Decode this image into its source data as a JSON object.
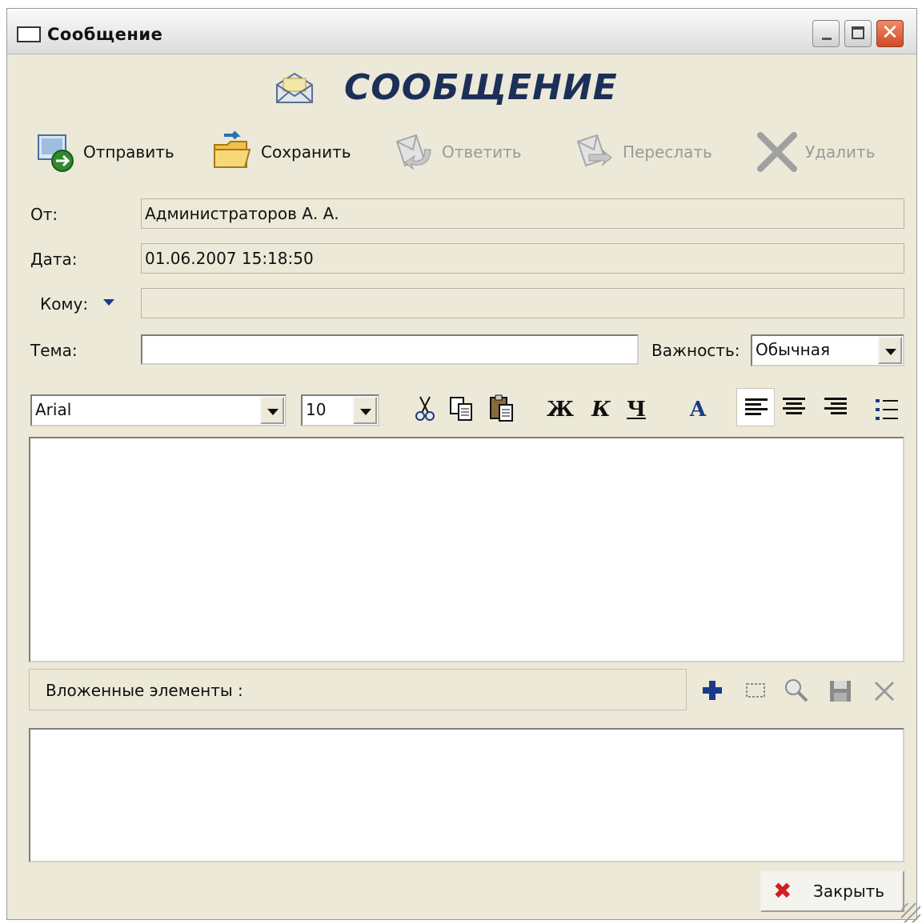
{
  "window": {
    "title": "Сообщение"
  },
  "heading": "СООБЩЕНИЕ",
  "toolbar": [
    {
      "label": "Отправить",
      "icon": "send-icon",
      "enabled": true
    },
    {
      "label": "Сохранить",
      "icon": "folder-save-icon",
      "enabled": true
    },
    {
      "label": "Ответить",
      "icon": "reply-icon",
      "enabled": false
    },
    {
      "label": "Переслать",
      "icon": "forward-icon",
      "enabled": false
    },
    {
      "label": "Удалить",
      "icon": "delete-icon",
      "enabled": false
    }
  ],
  "form": {
    "from_label": "От:",
    "from_value": "Администраторов А. А.",
    "date_label": "Дата:",
    "date_value": "01.06.2007 15:18:50",
    "to_label": "Кому:",
    "to_value": "",
    "subject_label": "Тема:",
    "subject_value": "",
    "importance_label": "Важность:",
    "importance_value": "Обычная"
  },
  "format": {
    "font": "Arial",
    "size": "10",
    "bold": "Ж",
    "italic": "К",
    "underline": "Ч",
    "color": "A"
  },
  "attachments": {
    "label": "Вложенные элементы :"
  },
  "buttons": {
    "close": "Закрыть"
  },
  "colors": {
    "window_bg": "#ece9d8",
    "heading": "#1c2f57",
    "close_x": "#d21e1e",
    "add": "#1a3a8a"
  }
}
